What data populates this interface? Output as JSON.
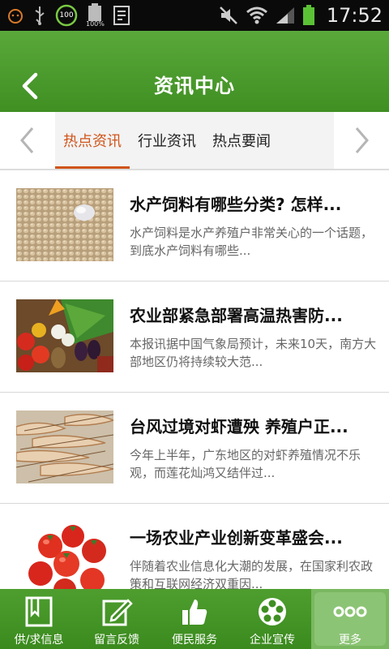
{
  "status_bar": {
    "time": "17:52",
    "battery_small_label": "100%",
    "badge_100": "100"
  },
  "header": {
    "title": "资讯中心",
    "back_icon": "chevron-left-icon"
  },
  "tabs": [
    {
      "label": "热点资讯",
      "active": true
    },
    {
      "label": "行业资讯",
      "active": false
    },
    {
      "label": "热点要闻",
      "active": false
    }
  ],
  "articles": [
    {
      "title": "水产饲料有哪些分类? 怎样...",
      "summary": " 水产饲料是水产养殖户非常关心的一个话题，到底水产饲料有哪些...",
      "image": "feed-pellets"
    },
    {
      "title": "农业部紧急部署高温热害防...",
      "summary": "本报讯据中国气象局预计，未来10天，南方大部地区仍将持续较大范...",
      "image": "vegetables"
    },
    {
      "title": "台风过境对虾遭殃 养殖户正...",
      "summary": "今年上半年，广东地区的对虾养殖情况不乐观，而莲花灿鸿又结伴过...",
      "image": "shrimp"
    },
    {
      "title": "一场农业产业创新变革盛会...",
      "summary": "伴随着农业信息化大潮的发展，在国家利农政策和互联网经济双重因...",
      "image": "tomatoes"
    }
  ],
  "bottom_nav": [
    {
      "label": "供/求信息",
      "icon": "book-icon",
      "active": false
    },
    {
      "label": "留言反馈",
      "icon": "edit-icon",
      "active": false
    },
    {
      "label": "便民服务",
      "icon": "thumbs-up-icon",
      "active": false
    },
    {
      "label": "企业宣传",
      "icon": "film-reel-icon",
      "active": false
    },
    {
      "label": "更多",
      "icon": "more-dots-icon",
      "active": true
    }
  ],
  "colors": {
    "header_green": "#4a9a2c",
    "active_tab": "#d0541a"
  }
}
